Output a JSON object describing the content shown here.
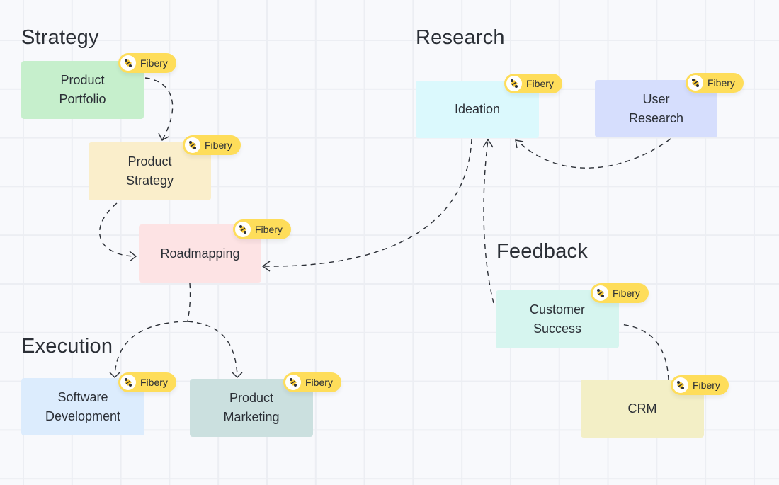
{
  "sections": {
    "strategy": "Strategy",
    "research": "Research",
    "feedback": "Feedback",
    "execution": "Execution"
  },
  "badge_label": "Fibery",
  "cards": {
    "product_portfolio": {
      "label": "Product\nPortfolio",
      "color": "#c6efcc"
    },
    "product_strategy": {
      "label": "Product\nStrategy",
      "color": "#faeecb"
    },
    "roadmapping": {
      "label": "Roadmapping",
      "color": "#fde3e4"
    },
    "ideation": {
      "label": "Ideation",
      "color": "#dbf9fd"
    },
    "user_research": {
      "label": "User\nResearch",
      "color": "#d6defd"
    },
    "customer_success": {
      "label": "Customer\nSuccess",
      "color": "#d6f5ef"
    },
    "crm": {
      "label": "CRM",
      "color": "#f3efc6"
    },
    "software_development": {
      "label": "Software\nDevelopment",
      "color": "#dcecfd"
    },
    "product_marketing": {
      "label": "Product\nMarketing",
      "color": "#cbe0df"
    }
  },
  "connections": [
    {
      "from": "Product Portfolio",
      "to": "Product Strategy"
    },
    {
      "from": "Product Strategy",
      "to": "Roadmapping"
    },
    {
      "from": "Ideation",
      "to": "Roadmapping"
    },
    {
      "from": "User Research",
      "to": "Ideation"
    },
    {
      "from": "Customer Success",
      "to": "Ideation"
    },
    {
      "from": "CRM",
      "to": "Customer Success"
    },
    {
      "from": "Roadmapping",
      "to": "Software Development"
    },
    {
      "from": "Roadmapping",
      "to": "Product Marketing"
    }
  ],
  "colors": {
    "badge": "#fedd5a",
    "ink": "#2b2f36",
    "grid": "#eceef3",
    "background": "#f8f9fc"
  }
}
